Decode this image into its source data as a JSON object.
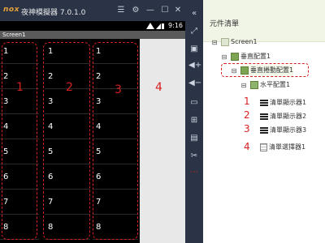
{
  "emulator": {
    "logo": "nox",
    "title": "夜神模擬器 7.0.1.0",
    "time": "9:16",
    "app_title": "Screen1"
  },
  "screen": {
    "columns": [
      {
        "items": [
          "1",
          "2",
          "3",
          "4",
          "5",
          "6",
          "7",
          "8"
        ]
      },
      {
        "items": [
          "1",
          "2",
          "3",
          "4",
          "5",
          "6",
          "7",
          "8"
        ]
      },
      {
        "items": [
          "1",
          "2",
          "3",
          "4",
          "5",
          "6",
          "7",
          "8"
        ]
      }
    ],
    "annotations": [
      "1",
      "2",
      "3",
      "4"
    ]
  },
  "panel": {
    "title": "元件清單",
    "tree": {
      "screen": "Screen1",
      "vertical": "垂直配置1",
      "vertical_scroll": "垂直捲動配置1",
      "horizontal": "水平配置1",
      "list1": "清單顯示器1",
      "list2": "清單顯示器2",
      "list3": "清單顯示器3",
      "picker": "清單選擇器1"
    },
    "annotations": [
      "1",
      "2",
      "3",
      "4"
    ]
  },
  "colors": {
    "annotation_red": "#d42020",
    "emulator_bar": "#2b3446",
    "panel_header": "#f0f5e6"
  }
}
